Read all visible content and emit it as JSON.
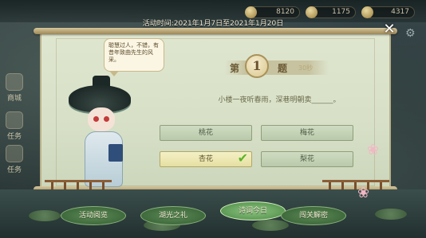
{
  "top_bar": {
    "resources": [
      "8120",
      "1175",
      "4317"
    ]
  },
  "side_menu": {
    "items": [
      "商城",
      "任务",
      "任务"
    ]
  },
  "event_time": "活动时间:2021年1月7日至2021年1月20日",
  "quiz": {
    "question_prefix": "第",
    "question_number": "1",
    "question_suffix": "题",
    "timer": "30秒",
    "question_text": "小楼一夜听春雨，深巷明朝卖______。",
    "options": [
      {
        "label": "桃花",
        "selected": false
      },
      {
        "label": "梅花",
        "selected": false
      },
      {
        "label": "杏花",
        "selected": true
      },
      {
        "label": "梨花",
        "selected": false
      }
    ]
  },
  "character": {
    "speech": "聪慧过人，不错，有昔年致曲先生的风采。"
  },
  "bottom_tabs": [
    {
      "label": "活动阅览",
      "active": false
    },
    {
      "label": "湖光之礼",
      "active": false
    },
    {
      "label": "诗词今日",
      "active": true
    },
    {
      "label": "闯关解密",
      "active": false
    }
  ],
  "colors": {
    "panel": "#dfe6cf",
    "option": "#cfdcc2",
    "selected_option": "#f4f0c6",
    "tab": "#3f6a3c",
    "check": "#5fb12d"
  }
}
